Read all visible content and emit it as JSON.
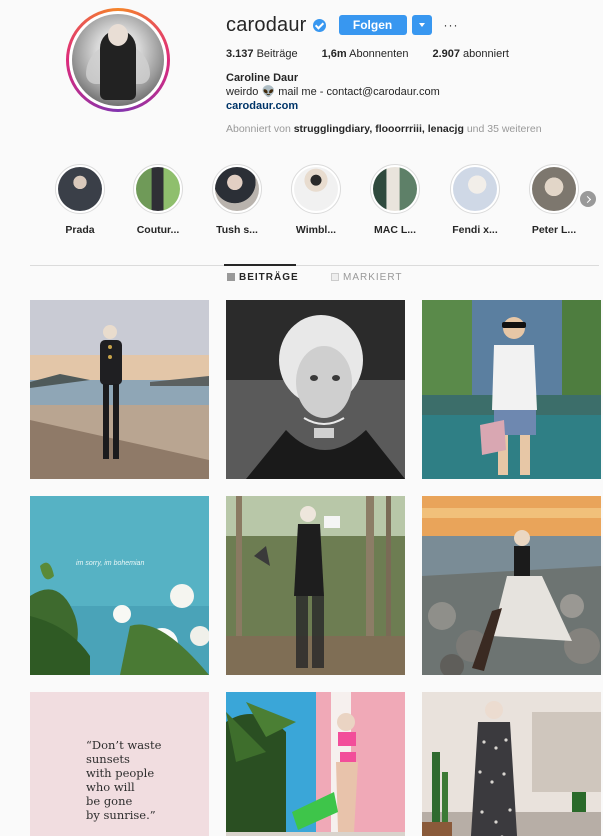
{
  "profile": {
    "username": "carodaur",
    "follow_label": "Folgen",
    "more_label": "···",
    "stats": [
      {
        "value": "3.137",
        "label": "Beiträge"
      },
      {
        "value": "1,6m",
        "label": "Abonnenten"
      },
      {
        "value": "2.907",
        "label": "abonniert"
      }
    ],
    "full_name": "Caroline Daur",
    "bio_line": "weirdo 👽 mail me - contact@carodaur.com",
    "website": "carodaur.com",
    "followed_by_prefix": "Abonniert von",
    "followed_by_names": "strugglingdiary, flooorrriii, lenacjg",
    "followed_by_suffix": "und 35 weiteren"
  },
  "highlights": [
    {
      "label": "Prada",
      "icon": "highlight-thumb",
      "color": "#3a3f48"
    },
    {
      "label": "Coutur...",
      "icon": "highlight-thumb",
      "color": "#4d7a4a"
    },
    {
      "label": "Tush s...",
      "icon": "highlight-thumb",
      "color": "#5f5350"
    },
    {
      "label": "Wimbl...",
      "icon": "highlight-thumb",
      "color": "#cfd6de"
    },
    {
      "label": "MAC L...",
      "icon": "highlight-thumb",
      "color": "#3f5a52"
    },
    {
      "label": "Fendi x...",
      "icon": "highlight-thumb",
      "color": "#d6dbe6"
    },
    {
      "label": "Peter L...",
      "icon": "highlight-thumb",
      "color": "#8f8a80"
    }
  ],
  "tabs": [
    {
      "label": "BEITRÄGE",
      "active": true
    },
    {
      "label": "MARKIERT",
      "active": false
    }
  ],
  "posts": [
    {
      "kind": "photo",
      "desc": "beach-sunset-blazer"
    },
    {
      "kind": "photo",
      "desc": "bw-selfie"
    },
    {
      "kind": "photo",
      "desc": "poolside-sunglasses"
    },
    {
      "kind": "photo",
      "desc": "sky-flowers",
      "overlay_text": "im sorry, im bohemian"
    },
    {
      "kind": "photo",
      "desc": "forest-sheer-outfit"
    },
    {
      "kind": "photo",
      "desc": "rocky-shore-tulle"
    },
    {
      "kind": "quote",
      "text": "“Don’t waste\nsunsets\nwith people\nwho will\nbe gone\nby sunrise.”"
    },
    {
      "kind": "photo",
      "desc": "palms-pink-bikini"
    },
    {
      "kind": "photo",
      "desc": "leopard-dress"
    }
  ],
  "colors": {
    "accent": "#3897f0",
    "text": "#262626",
    "muted": "#999999",
    "link": "#003569",
    "background": "#fafafa"
  }
}
